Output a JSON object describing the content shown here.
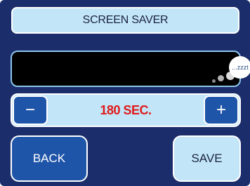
{
  "screen": {
    "title": "SCREEN SAVER"
  },
  "preview": {
    "bubble_text": "...zzzt"
  },
  "timeout": {
    "minus_label": "−",
    "plus_label": "+",
    "value": "180 SEC."
  },
  "actions": {
    "back_label": "BACK",
    "save_label": "SAVE"
  },
  "colors": {
    "background": "#1b2d6b",
    "light_button": "#c2e5f8",
    "dark_button": "#1f55a8",
    "value_text": "#e01b1b",
    "preview_border": "#8cc6ea"
  }
}
